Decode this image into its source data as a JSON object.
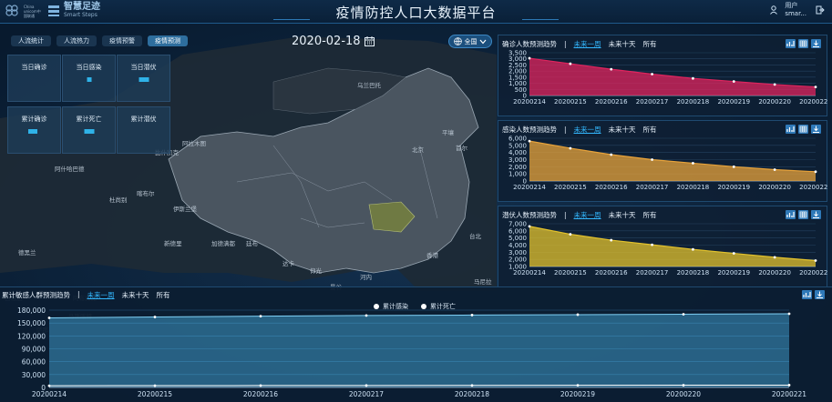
{
  "header": {
    "logo_small": "China unicom中国联通",
    "brand_cn": "智慧足迹",
    "brand_en": "Smart Steps",
    "title": "疫情防控人口大数据平台",
    "user_label": "用户",
    "user_name": "smar..."
  },
  "tabs": [
    {
      "label": "人流统计",
      "active": false
    },
    {
      "label": "人流热力",
      "active": false
    },
    {
      "label": "疫情预警",
      "active": false
    },
    {
      "label": "疫情预测",
      "active": true
    }
  ],
  "date": "2020-02-18",
  "region_selector": "全国",
  "stats": {
    "row1": [
      {
        "label": "当日确诊",
        "bar": 0
      },
      {
        "label": "当日感染",
        "bar": 0.3
      },
      {
        "label": "当日潜伏",
        "bar": 0.6
      }
    ],
    "row2": [
      {
        "label": "累计确诊",
        "bar": 0.4
      },
      {
        "label": "累计死亡",
        "bar": 0.5
      },
      {
        "label": "累计潜伏",
        "bar": 0
      }
    ]
  },
  "map_labels": [
    "乌兰巴托",
    "比什凯克",
    "阿拉木图",
    "阿什哈巴德",
    "杜尚别",
    "喀布尔",
    "伊斯兰堡",
    "新德里",
    "加德满都",
    "廷布",
    "达卡",
    "北京",
    "首尔",
    "平壤",
    "东京",
    "香港",
    "台北",
    "马尼拉",
    "河内",
    "曼谷",
    "仰光",
    "德黑兰",
    "巴格达",
    "利雅得",
    "阿布扎比",
    "马斯喀特",
    "萨那"
  ],
  "filters": {
    "sep": "|",
    "week": "未来一周",
    "ten_days": "未来十天",
    "all": "所有"
  },
  "colors": {
    "confirmed": "#e0245e",
    "infected": "#e8a33a",
    "latent": "#e3c22c",
    "cumulative": "#4ab4e6"
  },
  "chart_data": [
    {
      "type": "area",
      "title": "确诊人数预测趋势",
      "x": [
        "20200214",
        "20200215",
        "20200216",
        "20200217",
        "20200218",
        "20200219",
        "20200220",
        "20200221"
      ],
      "series": [
        {
          "values": [
            3050,
            2600,
            2150,
            1750,
            1400,
            1150,
            900,
            700
          ]
        }
      ],
      "yticks": [
        "0",
        "500",
        "1,000",
        "1,500",
        "2,000",
        "2,500",
        "3,000",
        "3,500"
      ],
      "ylim": [
        0,
        3500
      ]
    },
    {
      "type": "area",
      "title": "感染人数预测趋势",
      "x": [
        "20200214",
        "20200215",
        "20200216",
        "20200217",
        "20200218",
        "20200219",
        "20200220",
        "20200221"
      ],
      "series": [
        {
          "values": [
            5600,
            4600,
            3700,
            3000,
            2500,
            2000,
            1600,
            1300
          ]
        }
      ],
      "yticks": [
        "0",
        "1,000",
        "2,000",
        "3,000",
        "4,000",
        "5,000",
        "6,000"
      ],
      "ylim": [
        0,
        6000
      ]
    },
    {
      "type": "area",
      "title": "潜伏人数预测趋势",
      "x": [
        "20200214",
        "20200215",
        "20200216",
        "20200217",
        "20200218",
        "20200219",
        "20200220",
        "20200221"
      ],
      "series": [
        {
          "values": [
            7100,
            5900,
            5000,
            4300,
            3600,
            3000,
            2400,
            1900
          ]
        }
      ],
      "yticks": [
        "1,000",
        "2,000",
        "3,000",
        "4,000",
        "5,000",
        "6,000",
        "7,000"
      ],
      "ylim": [
        1000,
        7500
      ]
    },
    {
      "type": "line",
      "title": "累计敏感人群预测趋势",
      "x": [
        "20200214",
        "20200215",
        "20200216",
        "20200217",
        "20200218",
        "20200219",
        "20200220",
        "20200221"
      ],
      "series": [
        {
          "name": "累计感染",
          "values": [
            162000,
            164000,
            166000,
            167500,
            168500,
            169500,
            170500,
            171500
          ]
        },
        {
          "name": "累计死亡",
          "values": [
            4000,
            4200,
            4400,
            4600,
            4800,
            5000,
            5200,
            5400
          ]
        }
      ],
      "yticks": [
        "0",
        "30,000",
        "60,000",
        "90,000",
        "120,000",
        "150,000",
        "180,000"
      ],
      "ylim": [
        0,
        180000
      ]
    }
  ]
}
